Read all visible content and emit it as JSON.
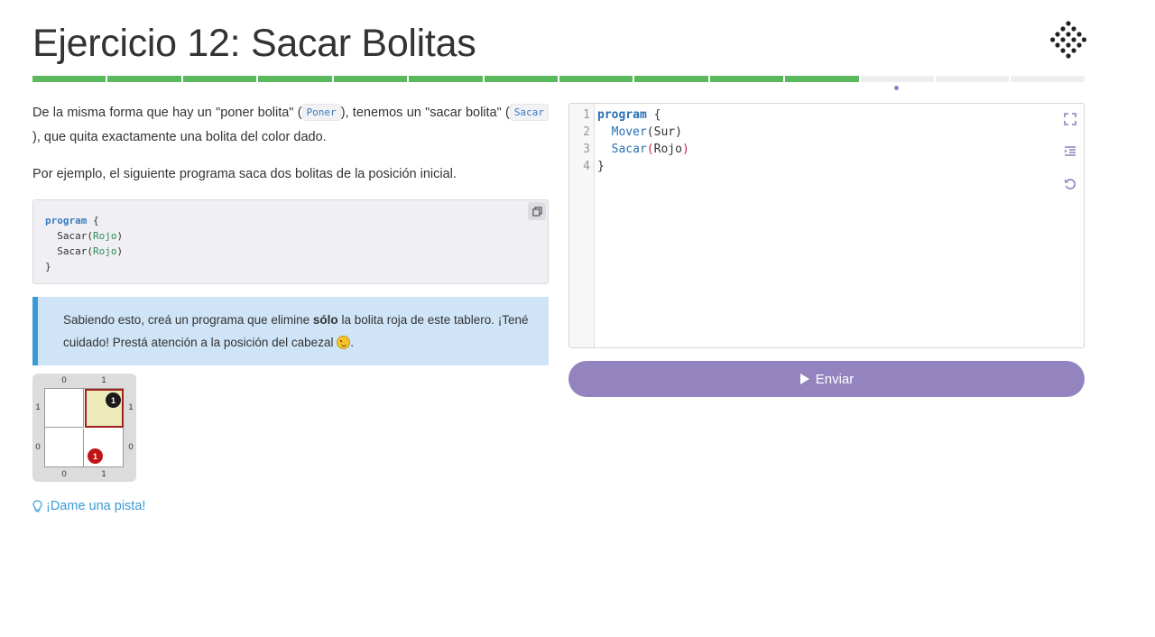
{
  "header": {
    "title": "Ejercicio 12: Sacar Bolitas"
  },
  "progress": {
    "total_segments": 14,
    "completed_segments": 11,
    "current_index": 11,
    "colors": {
      "done": "#5cb85c",
      "pending": "#eceeef",
      "current_marker": "#8e7fbd"
    }
  },
  "explanation": {
    "p1_a": "De la misma forma que hay un \"poner bolita\" (",
    "p1_code1": "Poner",
    "p1_b": "), tenemos un \"sacar bolita\" (",
    "p1_code2": "Sacar",
    "p1_c": "), que quita exactamente una bolita del color dado.",
    "p2": "Por ejemplo, el siguiente programa saca dos bolitas de la posición inicial."
  },
  "example_code": {
    "line1_kw": "program",
    "line1_rest": " {",
    "line2_fn": "  Sacar(",
    "line2_arg": "Rojo",
    "line2_end": ")",
    "line3_fn": "  Sacar(",
    "line3_arg": "Rojo",
    "line3_end": ")",
    "line4": "}",
    "copy_icon": "copy-icon"
  },
  "task_note": {
    "a": "Sabiendo esto, creá un programa que elimine ",
    "bold": "sólo",
    "b": " la bolita roja de este tablero. ¡Tené cuidado! Prestá atención a la posición del cabezal ",
    "c": ".",
    "emoji": "winking-face"
  },
  "board": {
    "col_labels": [
      "0",
      "1"
    ],
    "row_labels": [
      "1",
      "0"
    ],
    "cells": [
      {
        "col": 1,
        "row": 1,
        "head": true,
        "ball_color": "black",
        "count": "1"
      },
      {
        "col": 1,
        "row": 0,
        "head": false,
        "ball_color": "red",
        "count": "1"
      }
    ]
  },
  "hint": {
    "label": "¡Dame una pista!",
    "icon": "lightbulb-icon"
  },
  "editor": {
    "line_numbers": [
      "1",
      "2",
      "3",
      "4"
    ],
    "line1_kw": "program",
    "line1_rest": " {",
    "line2_fn": "  Mover",
    "line2_rest": "(Sur)",
    "line3_fn": "  Sacar",
    "line3_open": "(",
    "line3_arg": "Rojo",
    "line3_close": ")",
    "line4": "}",
    "icons": [
      "fullscreen-icon",
      "indent-icon",
      "reset-icon"
    ]
  },
  "submit": {
    "label": "Enviar",
    "icon": "play-icon",
    "color": "#9384c0"
  }
}
